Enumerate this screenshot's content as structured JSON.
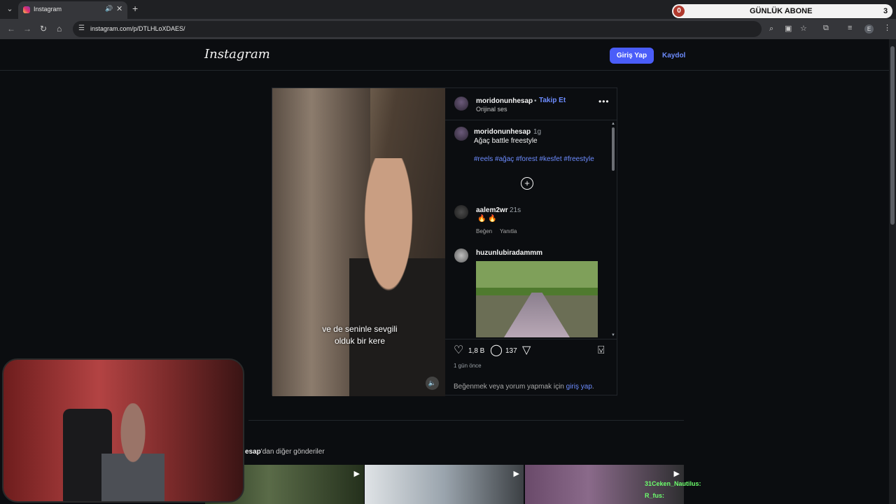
{
  "browser": {
    "tab": {
      "title": "Instagram"
    },
    "url": "instagram.com/p/DTLHLoXDAES/",
    "profile_initial": "E"
  },
  "sub_counter": {
    "left": "0",
    "title": "GÜNLÜK ABONE",
    "right": "3"
  },
  "header": {
    "logo": "Instagram",
    "login_label": "Giriş Yap",
    "signup_label": "Kaydol"
  },
  "post": {
    "author": "moridonunhesap",
    "follow_label": "Takip Et",
    "audio": "Orijinal ses",
    "caption": {
      "username": "moridonunhesap",
      "time": "1g",
      "text": "Ağaç battle freestyle",
      "hashtags": "#reels #ağaç #forest #kesfet #freestyle"
    },
    "video_subtitle_line1": "ve de seninle sevgili",
    "video_subtitle_line2": "olduk bir kere",
    "comments": [
      {
        "username": "aalem2wr",
        "time": "21s",
        "text": "🔥 🔥",
        "like_label": "Beğen",
        "reply_label": "Yanıtla"
      },
      {
        "username": "huzunlubiradammm",
        "time": "",
        "text": ""
      }
    ],
    "likes": "1,8 B",
    "comment_count": "137",
    "posted_ago": "1 gün önce",
    "login_prompt_prefix": "Beğenmek veya yorum yapmak için",
    "login_prompt_link": "giriş yap",
    "login_prompt_suffix": "."
  },
  "more_posts": {
    "username_part": "esap",
    "suffix": "'dan diğer gönderiler"
  },
  "chat": [
    {
      "user": "31Ceken_Nautilus:",
      "color": "#6dff6d"
    },
    {
      "user": "R_fus:",
      "color": "#6dff6d"
    }
  ],
  "colors": {
    "accent": "#4a5df9",
    "link": "#6d8cff",
    "background": "#0b0d10"
  }
}
